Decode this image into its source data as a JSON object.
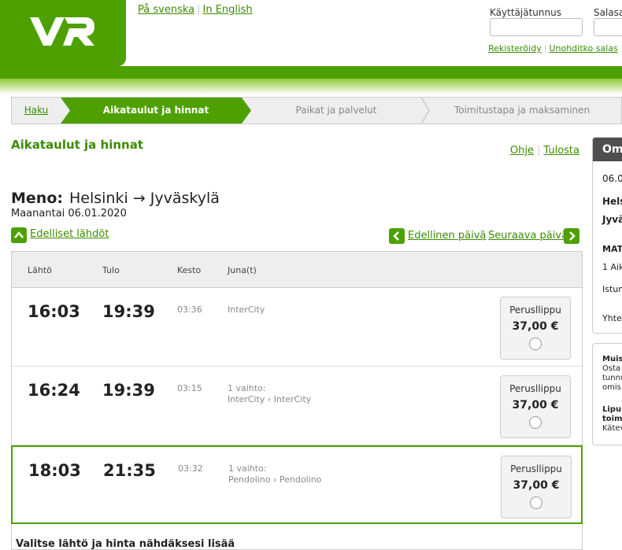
{
  "header": {
    "logo_text": "VR",
    "lang_swedish": "På svenska",
    "lang_english": "In English",
    "username_label": "Käyttäjätunnus",
    "password_label": "Salasa",
    "register_link": "Rekisteröidy",
    "forgot_link": "Unohditko salas"
  },
  "steps": {
    "haku": "Haku",
    "active": "Aikataulut ja hinnat",
    "step3": "Paikat ja palvelut",
    "step4": "Toimitustapa ja maksaminen"
  },
  "main": {
    "title": "Aikataulut ja hinnat",
    "help_link": "Ohje",
    "print_link": "Tulosta",
    "direction_label": "Meno:",
    "route": "Helsinki → Jyväskylä",
    "date": "Maanantai 06.01.2020",
    "prev_departures": "Edelliset lähdöt",
    "prev_day": "Edellinen päivä",
    "next_day": "Seuraava päivä",
    "below_text": "Valitse lähtö ja hinta nähdäksesi lisää"
  },
  "table": {
    "headers": {
      "depart": "Lähtö",
      "arrive": "Tulo",
      "duration": "Kesto",
      "train": "Juna(t)"
    },
    "rows": [
      {
        "depart": "16:03",
        "arrive": "19:39",
        "duration": "03:36",
        "line1": "InterCity",
        "line2": "",
        "fare_name": "Perusllippu",
        "price": "37,00 €"
      },
      {
        "depart": "16:24",
        "arrive": "19:39",
        "duration": "03:15",
        "line1": "1 vaihto:",
        "line2": "InterCity › InterCity",
        "fare_name": "Perusllippu",
        "price": "37,00 €"
      },
      {
        "depart": "18:03",
        "arrive": "21:35",
        "duration": "03:32",
        "line1": "1 vaihto:",
        "line2": "Pendolino › Pendolino",
        "fare_name": "Perusllippu",
        "price": "37,00 €"
      }
    ]
  },
  "sidebar": {
    "title": "Om",
    "date": "06.0",
    "from": "Hels",
    "to": "Jyvä",
    "section": "MAT",
    "item1": "1 Aik",
    "item2": "Istun",
    "total": "Yhte",
    "reminder_title": "Muis",
    "reminder_l1": "Osta",
    "reminder_l2": "tunnu",
    "reminder_l3": "omis",
    "delivery_title1": "Lipu",
    "delivery_title2": "toim",
    "delivery_l1": "Kätev"
  },
  "colors": {
    "brand_green": "#4ea000",
    "link_green": "#3a8c00"
  }
}
